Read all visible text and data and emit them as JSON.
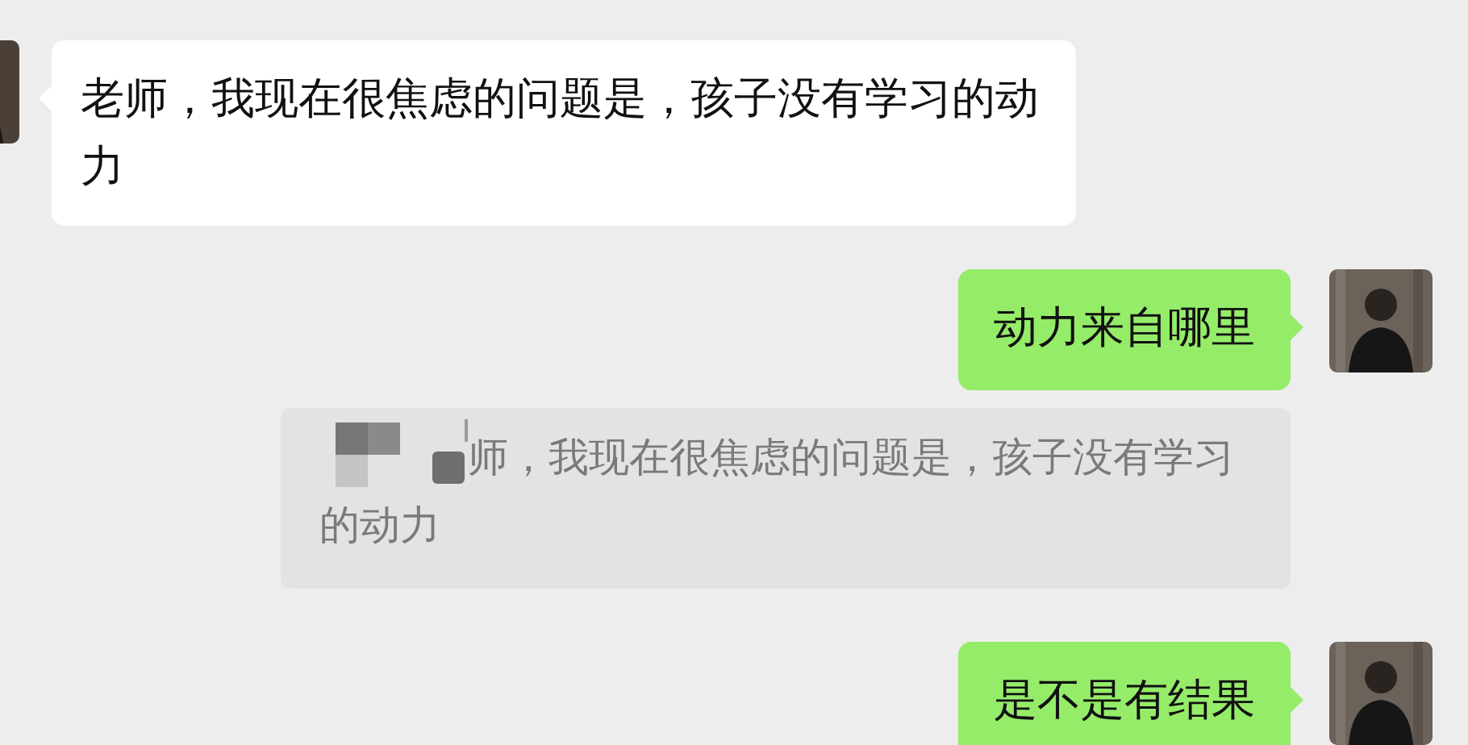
{
  "messages": [
    {
      "kind": "incoming",
      "text": "老师，我现在很焦虑的问题是，孩子没有学习的动力"
    },
    {
      "kind": "outgoing",
      "text": "动力来自哪里"
    },
    {
      "kind": "quote",
      "text": "师，我现在很焦虑的问题是，孩子没有学习的动力"
    },
    {
      "kind": "outgoing",
      "text": "是不是有结果"
    }
  ]
}
